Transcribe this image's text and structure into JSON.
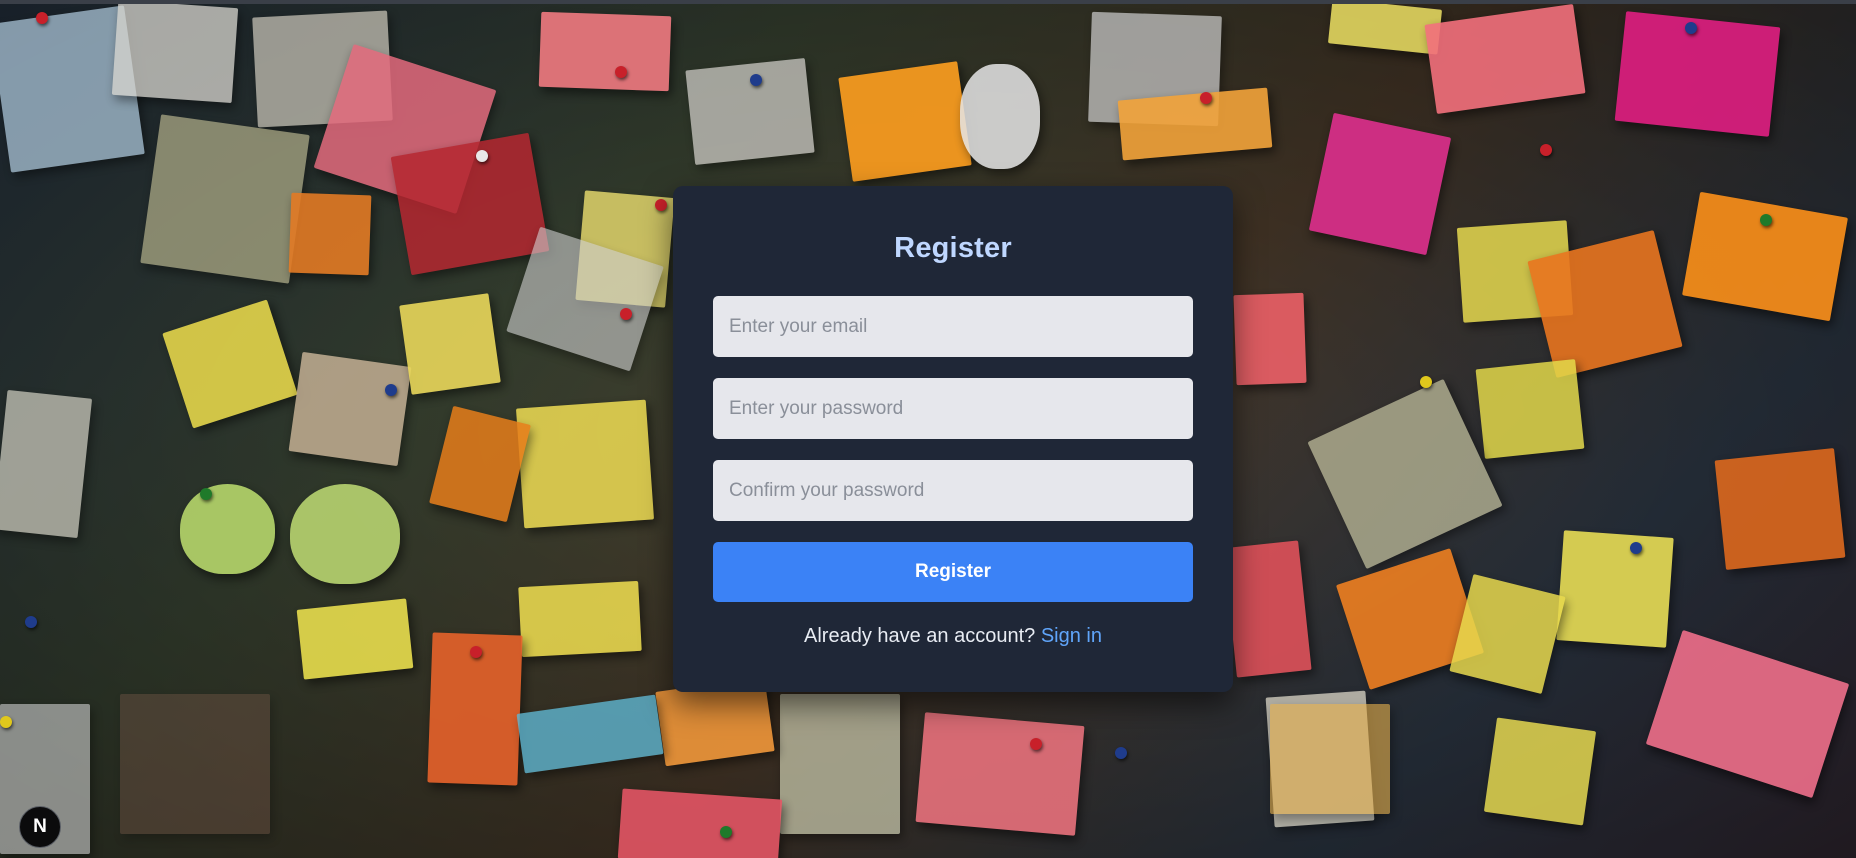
{
  "colors": {
    "card_background": "#1f2737",
    "title": "#bfd7ff",
    "input_background": "#e6e7ec",
    "placeholder": "#8a8f99",
    "primary_button": "#3b82f6",
    "link": "#60a5fa"
  },
  "form": {
    "title": "Register",
    "email": {
      "value": "",
      "placeholder": "Enter your email"
    },
    "password": {
      "value": "",
      "placeholder": "Enter your password"
    },
    "confirm_password": {
      "value": "",
      "placeholder": "Confirm your password"
    },
    "submit_label": "Register",
    "footer_text": "Already have an account?",
    "footer_link": "Sign in"
  },
  "badge": {
    "letter": "N"
  }
}
